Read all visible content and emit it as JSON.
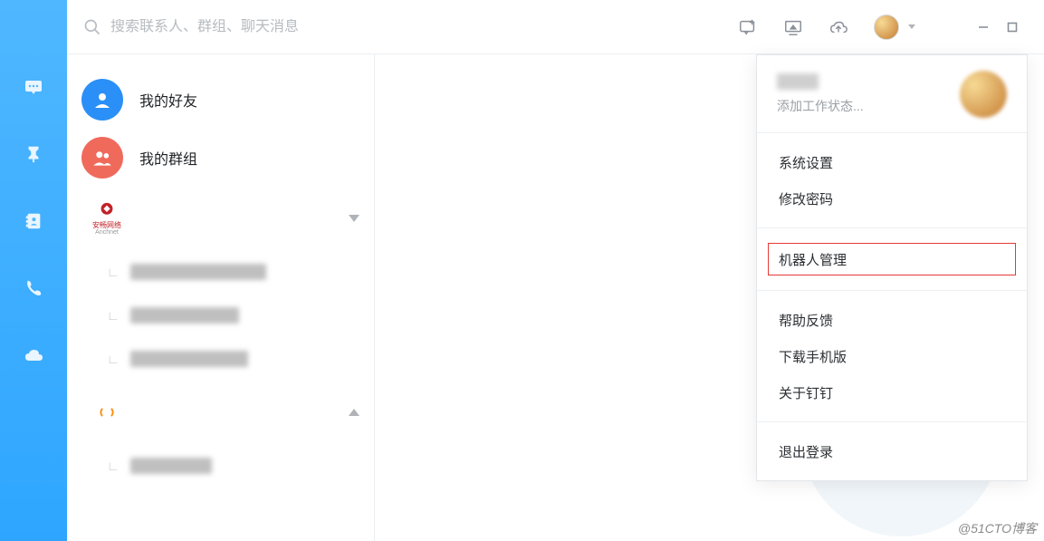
{
  "header": {
    "search_placeholder": "搜索联系人、群组、聊天消息"
  },
  "nav": {
    "items": [
      "chat-icon",
      "pin-icon",
      "contacts-icon",
      "phone-icon",
      "cloud-icon"
    ]
  },
  "contacts": {
    "friends_label": "我的好友",
    "groups_label": "我的群组",
    "org1_name": "安畅网络",
    "org1_sub": "Anchnet",
    "org2_name": "Aliyun+"
  },
  "dropdown": {
    "status_prompt": "添加工作状态...",
    "sections": [
      {
        "items": [
          {
            "label": "系统设置"
          },
          {
            "label": "修改密码"
          }
        ]
      },
      {
        "items": [
          {
            "label": "机器人管理",
            "highlight": true
          }
        ]
      },
      {
        "items": [
          {
            "label": "帮助反馈"
          },
          {
            "label": "下载手机版"
          },
          {
            "label": "关于钉钉"
          }
        ]
      },
      {
        "items": [
          {
            "label": "退出登录"
          }
        ]
      }
    ]
  },
  "watermark": "@51CTO博客"
}
